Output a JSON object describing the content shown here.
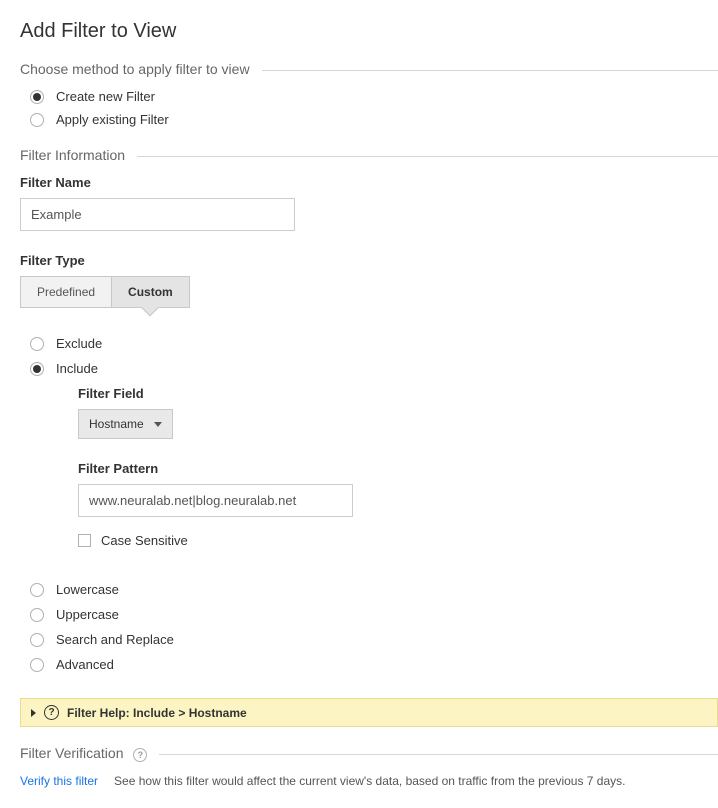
{
  "page_title": "Add Filter to View",
  "method_section": {
    "title": "Choose method to apply filter to view",
    "options": {
      "create_new": "Create new Filter",
      "apply_existing": "Apply existing Filter"
    }
  },
  "info_section_title": "Filter Information",
  "filter_name": {
    "label": "Filter Name",
    "value": "Example"
  },
  "filter_type": {
    "label": "Filter Type",
    "tabs": {
      "predefined": "Predefined",
      "custom": "Custom"
    }
  },
  "custom_options": {
    "exclude": "Exclude",
    "include": "Include",
    "lowercase": "Lowercase",
    "uppercase": "Uppercase",
    "search_replace": "Search and Replace",
    "advanced": "Advanced"
  },
  "include_fields": {
    "filter_field_label": "Filter Field",
    "filter_field_value": "Hostname",
    "filter_pattern_label": "Filter Pattern",
    "filter_pattern_value": "www.neuralab.net|blog.neuralab.net",
    "case_sensitive": "Case Sensitive"
  },
  "help_bar": {
    "q": "?",
    "text": "Filter Help: Include  >  Hostname"
  },
  "verification": {
    "title": "Filter Verification",
    "q": "?",
    "link": "Verify this filter",
    "desc": "See how this filter would affect the current view's data, based on traffic from the previous 7 days."
  }
}
